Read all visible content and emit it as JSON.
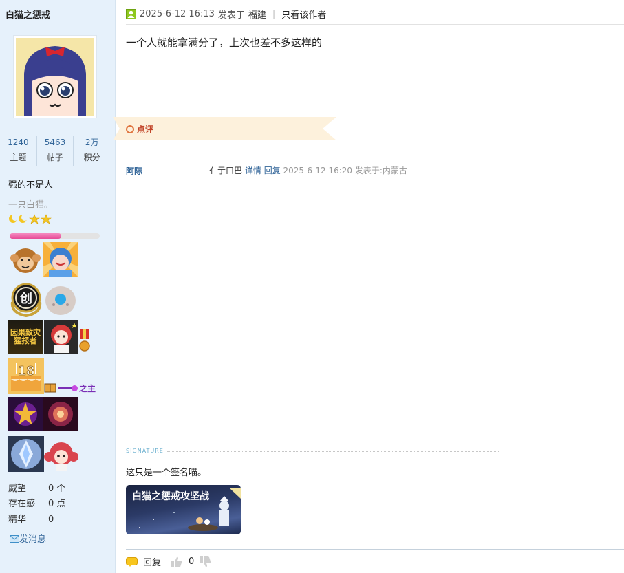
{
  "author": {
    "name": "白猫之惩戒",
    "stats": [
      {
        "value": "1240",
        "label": "主题"
      },
      {
        "value": "5463",
        "label": "帖子"
      },
      {
        "value": "2万",
        "label": "积分"
      }
    ],
    "title": "强的不是人",
    "subtitle": "一只白猫。",
    "rank_icons": [
      "moon-icon",
      "moon-icon",
      "star-icon",
      "star-icon"
    ],
    "level_progress": 0.57,
    "medal_text_18": "18",
    "medal_text_creative": "创",
    "medal_text_event": "因果致灾\n猛报者",
    "medal_text_small": "之主",
    "extra": [
      {
        "key": "威望",
        "value": "0 个"
      },
      {
        "key": "存在感",
        "value": "0 点"
      },
      {
        "key": "精华",
        "value": "0"
      }
    ],
    "send_message": "发消息"
  },
  "post": {
    "date": "2025-6-12 16:13",
    "posted_in": "发表于",
    "location": "福建",
    "only_author": "只看该作者",
    "content": "一个人就能拿满分了，上次也差不多这样的",
    "review_label": "点评"
  },
  "comment": {
    "user": "阿际",
    "text": "亻亍口巴",
    "detail": "详情",
    "reply": "回复",
    "time": "2025-6-12 16:20 发表于:内蒙古"
  },
  "signature": {
    "label": "SIGNATURE",
    "text": "这只是一个签名喵。",
    "banner_text": "白猫之惩戒攻坚战"
  },
  "footer": {
    "reply": "回复",
    "like_count": "0"
  },
  "colors": {
    "link": "#336699",
    "sidebar_bg": "#e6f1fb",
    "review_tab": "#fdf1dc",
    "progress": "#e64b97"
  }
}
